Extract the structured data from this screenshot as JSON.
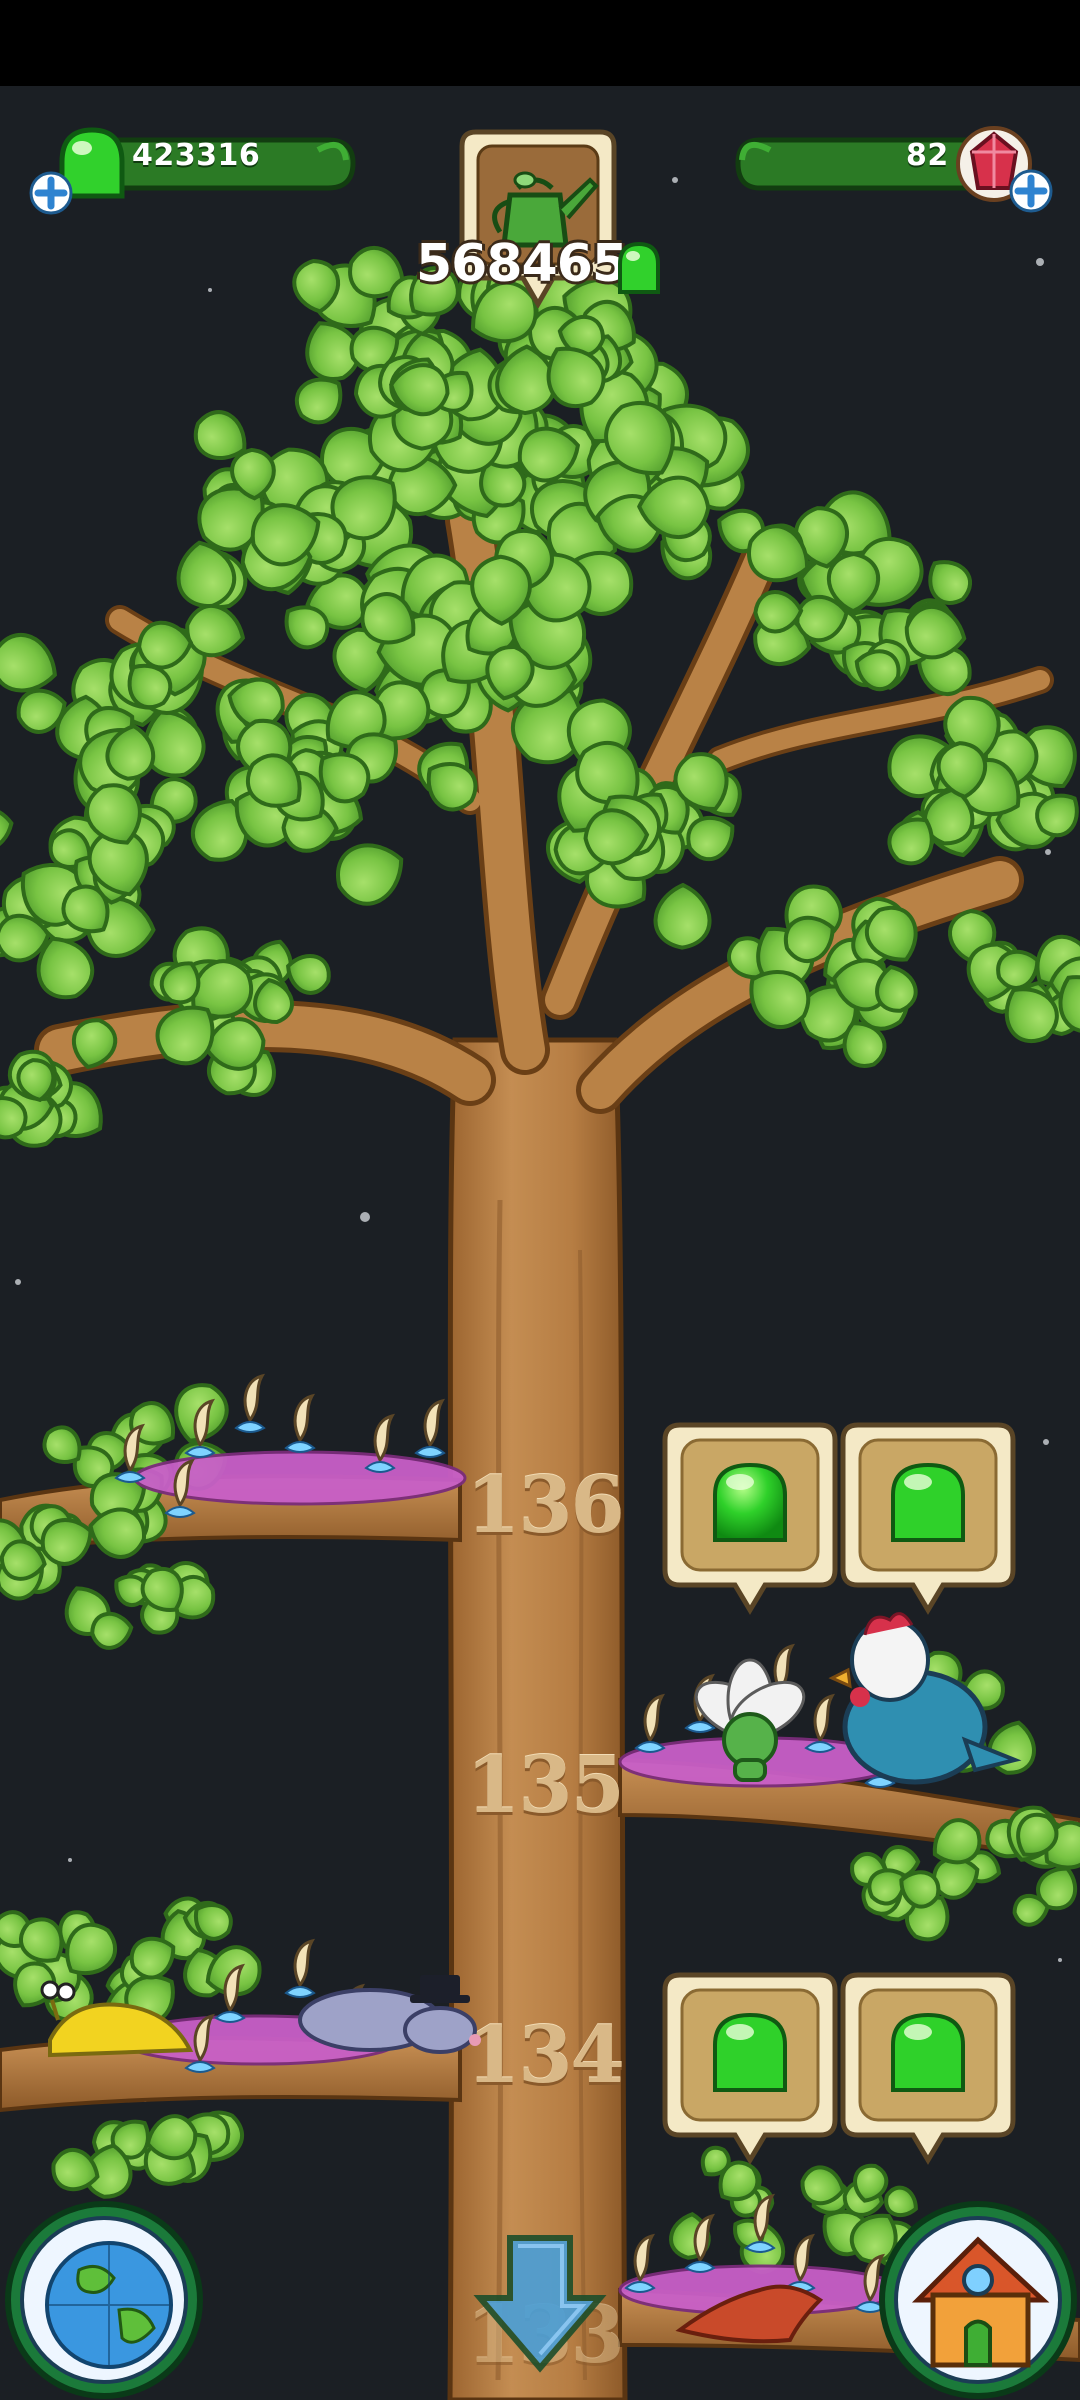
{
  "hud": {
    "gems": {
      "value": "423316",
      "icon": "green-gem-icon",
      "add_icon": "plus-icon"
    },
    "crystals": {
      "value": "82",
      "icon": "red-crystal-icon",
      "add_icon": "plus-icon"
    },
    "watering": {
      "value": "568465",
      "icon": "watering-can-icon",
      "currency_icon": "green-gem-icon"
    }
  },
  "branches": [
    {
      "number": "136"
    },
    {
      "number": "135"
    },
    {
      "number": "134"
    },
    {
      "number": "133"
    }
  ],
  "bottom_bar": {
    "left_icon": "globe-icon",
    "center_icon": "down-arrow-icon",
    "right_icon": "house-icon"
  },
  "colors": {
    "background": "#1b1f24",
    "leaf": "#7cc64a",
    "trunk": "#b98246",
    "gem": "#3fd13a",
    "hud_bar": "#2f8a2a",
    "crystal": "#d7314b"
  }
}
